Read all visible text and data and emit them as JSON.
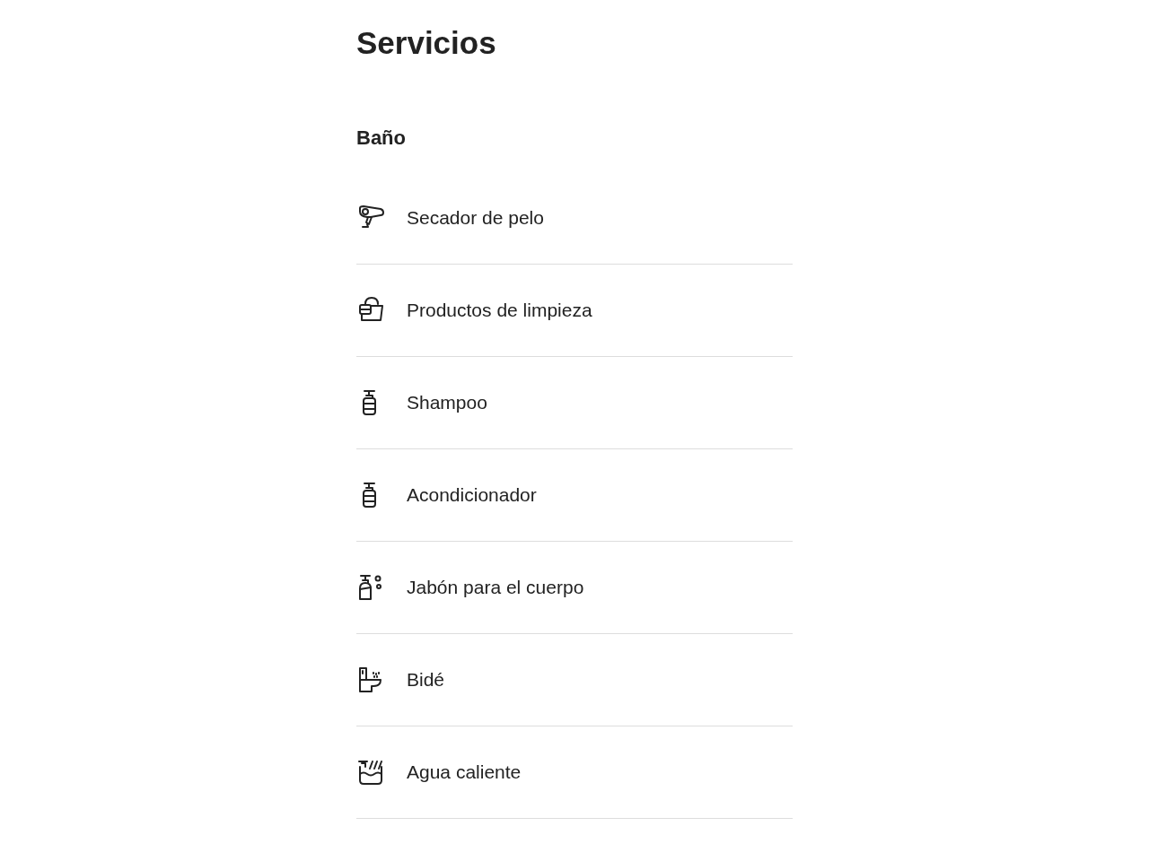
{
  "title": "Servicios",
  "section": {
    "heading": "Baño",
    "items": [
      {
        "kind": "dryer",
        "label": "Secador de pelo"
      },
      {
        "kind": "cleaning",
        "label": "Productos de limpieza"
      },
      {
        "kind": "pump",
        "label": "Shampoo"
      },
      {
        "kind": "pump",
        "label": "Acondicionador"
      },
      {
        "kind": "soap",
        "label": "Jabón para el cuerpo"
      },
      {
        "kind": "bidet",
        "label": "Bidé"
      },
      {
        "kind": "hotwater",
        "label": "Agua caliente"
      }
    ]
  }
}
